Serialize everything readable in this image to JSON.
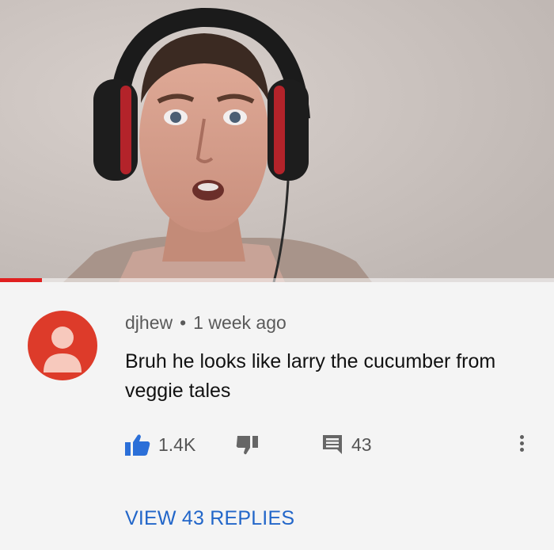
{
  "video": {
    "progress": 0.075,
    "accent": "#e02020"
  },
  "comment": {
    "avatar_icon": "user-avatar-icon",
    "avatar_color": "#dd3b2a",
    "author": "djhew",
    "separator": "•",
    "time": "1 week ago",
    "text": "Bruh he looks like larry the cucumber from veggie tales",
    "like_icon": "thumbs-up-icon",
    "like_count": "1.4K",
    "dislike_icon": "thumbs-down-icon",
    "reply_icon": "reply-comment-icon",
    "reply_count": "43",
    "more_icon": "more-vertical-icon",
    "view_replies": "VIEW 43 REPLIES",
    "link_color": "#2266c9"
  }
}
